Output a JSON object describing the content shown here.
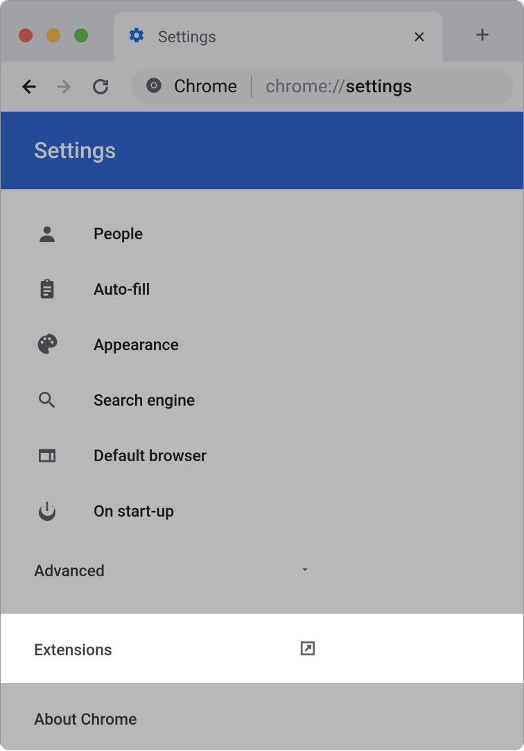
{
  "window": {
    "tab_title": "Settings",
    "omnibox_prefix": "Chrome",
    "omnibox_url_light": "chrome://",
    "omnibox_url_dark": "settings"
  },
  "header": {
    "title": "Settings"
  },
  "nav": {
    "items": [
      {
        "id": "people",
        "icon": "person-icon",
        "label": "People"
      },
      {
        "id": "autofill",
        "icon": "clipboard-icon",
        "label": "Auto-fill"
      },
      {
        "id": "appearance",
        "icon": "palette-icon",
        "label": "Appearance"
      },
      {
        "id": "search-engine",
        "icon": "search-icon",
        "label": "Search engine"
      },
      {
        "id": "default-browser",
        "icon": "browser-icon",
        "label": "Default browser"
      },
      {
        "id": "on-startup",
        "icon": "power-icon",
        "label": "On start-up"
      }
    ],
    "advanced_label": "Advanced",
    "extensions_label": "Extensions",
    "about_label": "About Chrome"
  },
  "colors": {
    "header_blue": "#3367d6",
    "accent_blue": "#1a73e8",
    "text_primary": "#202124",
    "text_secondary": "#5f6368"
  }
}
